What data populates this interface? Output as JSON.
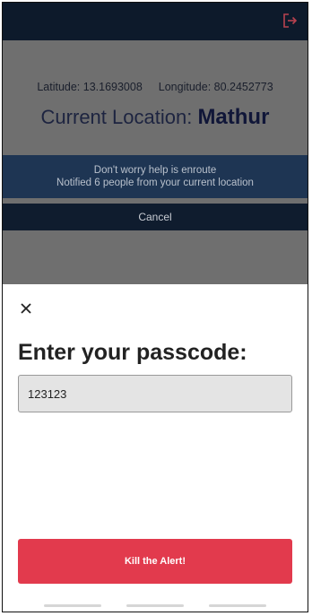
{
  "header": {
    "logout_icon": "logout-icon",
    "accent": "#e23a4d"
  },
  "location": {
    "latitude_text": "Latitude: 13.1693008",
    "longitude_text": "Longitude: 80.2452773",
    "current_label": "Current Location:",
    "name": "Mathur"
  },
  "notice": {
    "line1": "Don't worry help is enroute",
    "line2": "Notified 6 people from your current location"
  },
  "cancel_label": "Cancel",
  "sheet": {
    "close_icon": "close-icon",
    "title": "Enter your passcode:",
    "passcode_value": "123123",
    "kill_label": "Kill the Alert!",
    "kill_color": "#e23a4d"
  }
}
